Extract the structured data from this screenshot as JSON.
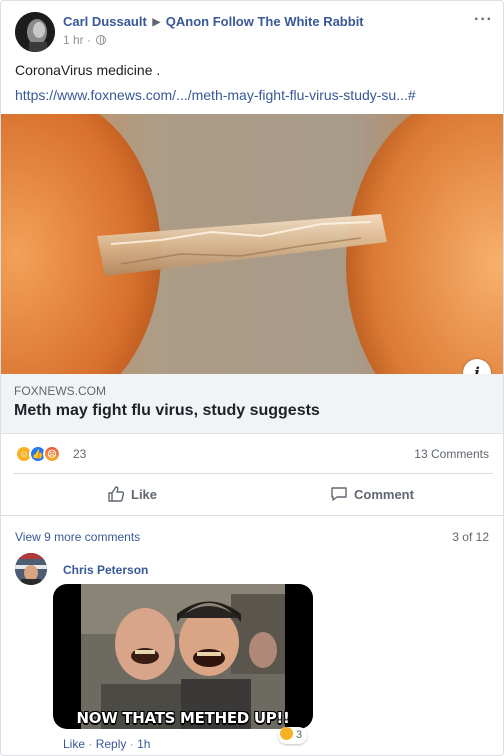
{
  "post": {
    "author": "Carl Dussault",
    "group": "QAnon Follow The White Rabbit",
    "time": "1 hr · ",
    "text": "CoronaVirus medicine .",
    "link": "https://www.foxnews.com/.../meth-may-fight-flu-virus-study-su...#",
    "menu_icon": "more-icon"
  },
  "preview": {
    "domain": "FOXNEWS.COM",
    "headline": "Meth may fight flu virus, study suggests",
    "info_glyph": "i"
  },
  "reactions": {
    "types": [
      "haha",
      "like",
      "angry"
    ],
    "count": "23",
    "comments": "13 Comments"
  },
  "actions": {
    "like": "Like",
    "comment": "Comment"
  },
  "comments": {
    "view_more": "View 9 more comments",
    "pager": "3 of 12",
    "items": [
      {
        "name": "Chris Peterson",
        "image_caption": "NOW THATS METHED UP!!",
        "reaction_count": "3",
        "like": "Like",
        "reply": "Reply",
        "time": "1h"
      }
    ]
  },
  "colors": {
    "link": "#385898",
    "muted": "#606770",
    "haha": "#f7b125",
    "like": "#2078f4"
  }
}
